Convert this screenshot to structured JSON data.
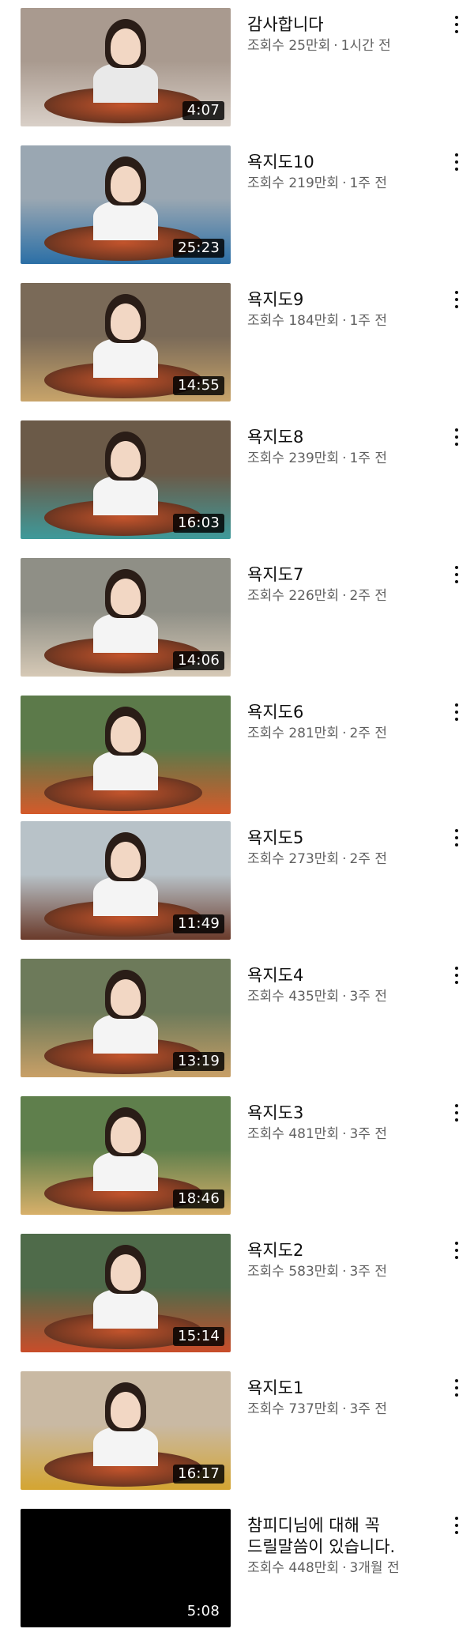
{
  "videos": [
    {
      "title": "감사합니다",
      "views": "조회수 25만회",
      "age": "1시간 전",
      "duration": "4:07",
      "palette": [
        "#a99a8f",
        "#d9d0c8"
      ]
    },
    {
      "title": "욕지도10",
      "views": "조회수 219만회",
      "age": "1주 전",
      "duration": "25:23",
      "palette": [
        "#9aa7b2",
        "#2b6fa6"
      ]
    },
    {
      "title": "욕지도9",
      "views": "조회수 184만회",
      "age": "1주 전",
      "duration": "14:55",
      "palette": [
        "#7a6a58",
        "#c8a46a"
      ]
    },
    {
      "title": "욕지도8",
      "views": "조회수 239만회",
      "age": "1주 전",
      "duration": "16:03",
      "palette": [
        "#6b5a48",
        "#3e9a9a"
      ]
    },
    {
      "title": "욕지도7",
      "views": "조회수 226만회",
      "age": "2주 전",
      "duration": "14:06",
      "palette": [
        "#8f8f86",
        "#d6c9b6"
      ]
    },
    {
      "title": "욕지도6",
      "views": "조회수 281만회",
      "age": "2주 전",
      "duration": "",
      "palette": [
        "#5c7a4a",
        "#d45a2a"
      ]
    },
    {
      "title": "욕지도5",
      "views": "조회수 273만회",
      "age": "2주 전",
      "duration": "11:49",
      "palette": [
        "#b8c2c8",
        "#6a3a2a"
      ]
    },
    {
      "title": "욕지도4",
      "views": "조회수 435만회",
      "age": "3주 전",
      "duration": "13:19",
      "palette": [
        "#6d7a5a",
        "#c9a067"
      ]
    },
    {
      "title": "욕지도3",
      "views": "조회수 481만회",
      "age": "3주 전",
      "duration": "18:46",
      "palette": [
        "#5f7f4c",
        "#d8b06a"
      ]
    },
    {
      "title": "욕지도2",
      "views": "조회수 583만회",
      "age": "3주 전",
      "duration": "15:14",
      "palette": [
        "#4f6b4a",
        "#c94d2a"
      ]
    },
    {
      "title": "욕지도1",
      "views": "조회수 737만회",
      "age": "3주 전",
      "duration": "16:17",
      "palette": [
        "#c9b9a3",
        "#d4a531"
      ]
    },
    {
      "title": "참피디님에 대해 꼭\n드릴말씀이 있습니다.",
      "views": "조회수 448만회",
      "age": "3개월 전",
      "duration": "5:08",
      "palette": [
        "#000000",
        "#000000"
      ]
    }
  ],
  "separator": "·",
  "icons": {
    "more": "more-vertical-icon"
  }
}
